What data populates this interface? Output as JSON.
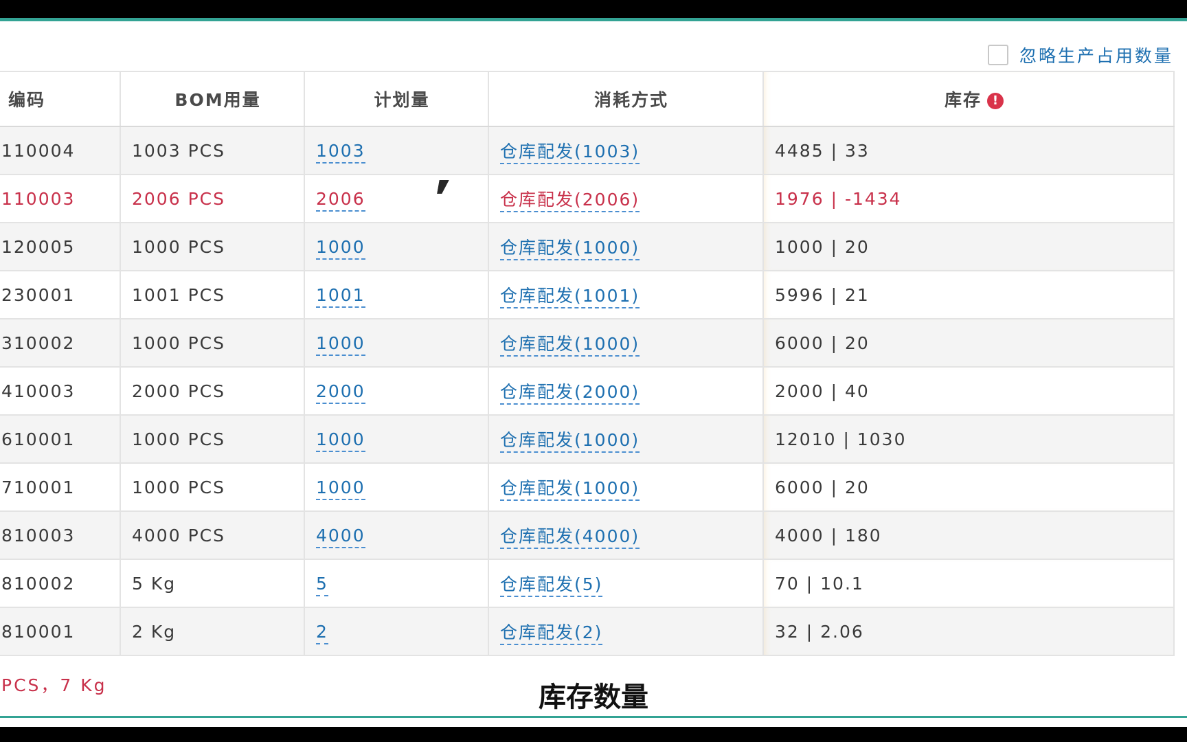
{
  "options": {
    "ignore_label": "忽略生产占用数量",
    "ignore_checked": false
  },
  "table": {
    "headers": {
      "code": "编码",
      "bom": "BOM用量",
      "plan": "计划量",
      "consume": "消耗方式",
      "stock": "库存"
    },
    "rows": [
      {
        "code": "110004",
        "bom": "1003 PCS",
        "plan": "1003",
        "consume": "仓库配发(1003)",
        "stock": "4485 | 33",
        "warning": false
      },
      {
        "code": "110003",
        "bom": "2006 PCS",
        "plan": "2006",
        "consume": "仓库配发(2006)",
        "stock": "1976 | -1434",
        "warning": true
      },
      {
        "code": "120005",
        "bom": "1000 PCS",
        "plan": "1000",
        "consume": "仓库配发(1000)",
        "stock": "1000 | 20",
        "warning": false
      },
      {
        "code": "230001",
        "bom": "1001 PCS",
        "plan": "1001",
        "consume": "仓库配发(1001)",
        "stock": "5996 | 21",
        "warning": false
      },
      {
        "code": "310002",
        "bom": "1000 PCS",
        "plan": "1000",
        "consume": "仓库配发(1000)",
        "stock": "6000 | 20",
        "warning": false
      },
      {
        "code": "410003",
        "bom": "2000 PCS",
        "plan": "2000",
        "consume": "仓库配发(2000)",
        "stock": "2000 | 40",
        "warning": false
      },
      {
        "code": "610001",
        "bom": "1000 PCS",
        "plan": "1000",
        "consume": "仓库配发(1000)",
        "stock": "12010 | 1030",
        "warning": false
      },
      {
        "code": "710001",
        "bom": "1000 PCS",
        "plan": "1000",
        "consume": "仓库配发(1000)",
        "stock": "6000 | 20",
        "warning": false
      },
      {
        "code": "810003",
        "bom": "4000 PCS",
        "plan": "4000",
        "consume": "仓库配发(4000)",
        "stock": "4000 | 180",
        "warning": false
      },
      {
        "code": "810002",
        "bom": "5 Kg",
        "plan": "5",
        "consume": "仓库配发(5)",
        "stock": "70 | 10.1",
        "warning": false
      },
      {
        "code": "810001",
        "bom": "2 Kg",
        "plan": "2",
        "consume": "仓库配发(2)",
        "stock": "32 | 2.06",
        "warning": false
      }
    ]
  },
  "summary": "PCS，7 Kg",
  "subtitle": "库存数量",
  "colors": {
    "accent": "#33a394",
    "link": "#1d6fb0",
    "warning": "#c8304a"
  }
}
